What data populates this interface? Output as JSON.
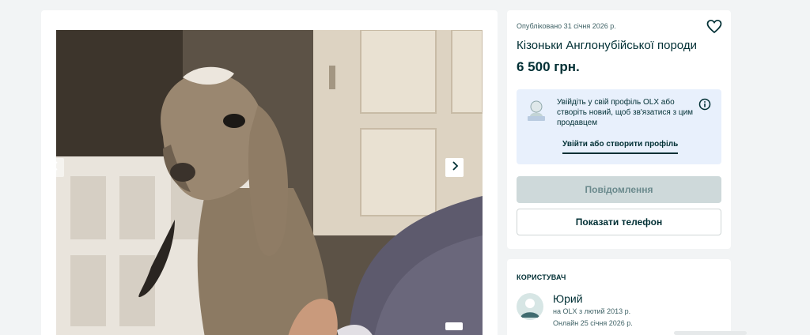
{
  "gallery": {
    "prev_icon": "chevron-left-icon",
    "next_icon": "chevron-right-icon",
    "photo_subject": "goat-kid-photo"
  },
  "ad": {
    "published": "Опубліковано 31 січня 2026 р.",
    "favorite_icon": "heart-icon",
    "title": "Кізоньки Англонубійської породи",
    "price": "6 500 грн."
  },
  "login_prompt": {
    "text": "Увійдіть у свій профіль OLX або створіть новий, щоб зв'язатися з цим продавцем",
    "link": "Увійти або створити профіль",
    "info_icon": "info-icon"
  },
  "actions": {
    "message": "Повідомлення",
    "show_phone": "Показати телефон"
  },
  "seller": {
    "heading": "КОРИСТУВАЧ",
    "name": "Юрий",
    "since": "на OLX з лютий 2013 р.",
    "online": "Онлайн 25 січня 2026 р."
  },
  "colors": {
    "background": "#f2f4f5",
    "text": "#002f34",
    "login_box": "#e8f0fc",
    "disabled_button": "#ced9da"
  }
}
